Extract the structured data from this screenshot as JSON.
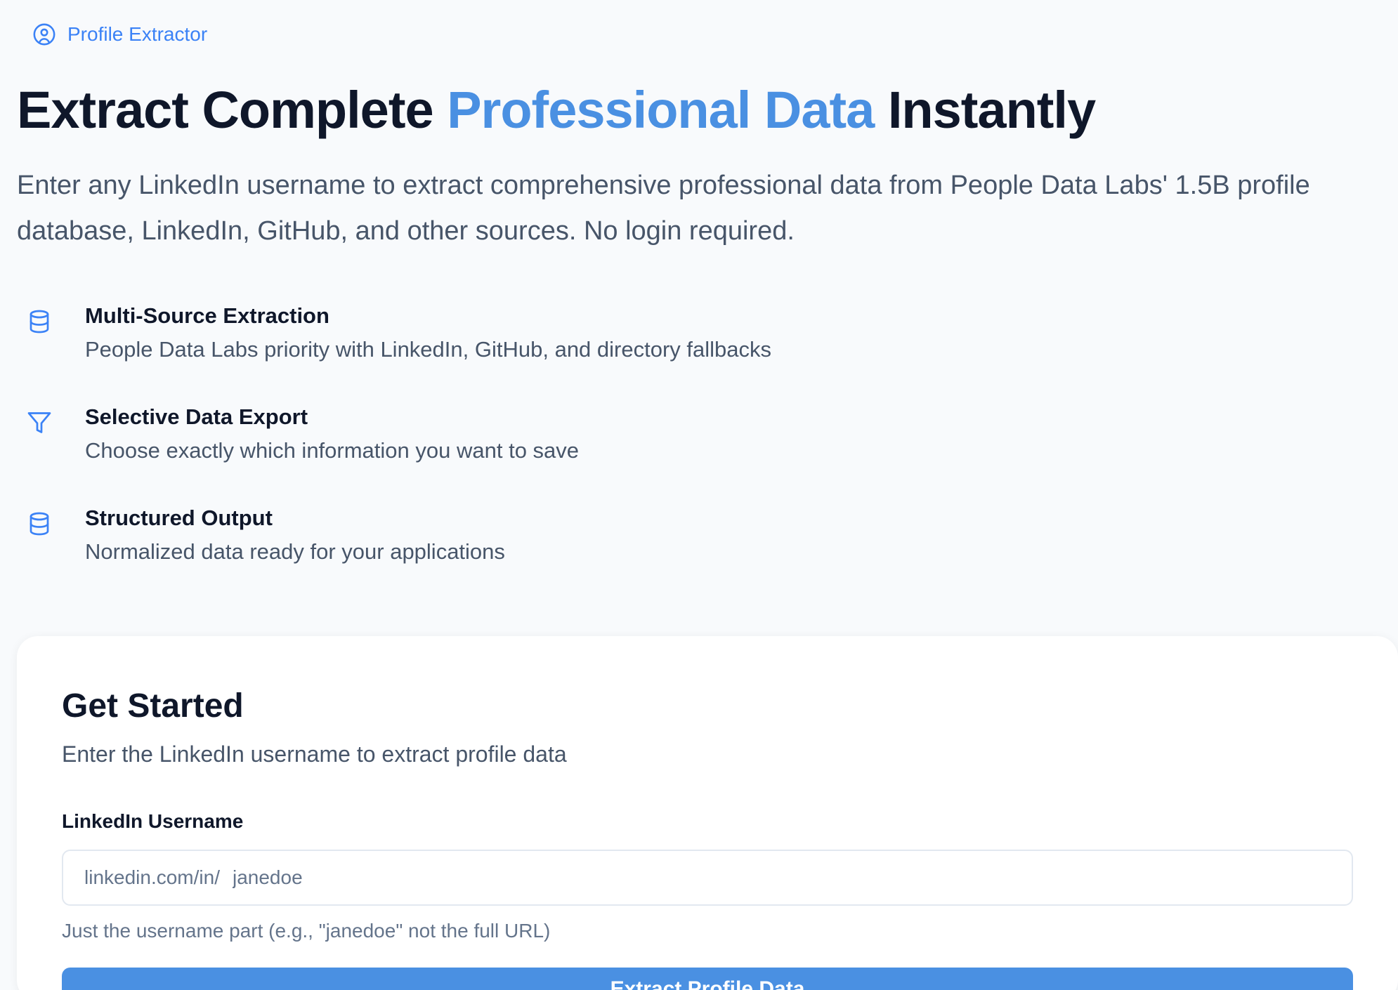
{
  "brand": {
    "label": "Profile Extractor",
    "icon": "user-circle-icon"
  },
  "hero": {
    "headline_before": "Extract Complete ",
    "headline_accent": "Professional Data",
    "headline_after": " Instantly",
    "lead": "Enter any LinkedIn username to extract comprehensive professional data from People Data Labs' 1.5B profile database, LinkedIn, GitHub, and other sources. No login required."
  },
  "features": [
    {
      "icon": "database-icon",
      "title": "Multi-Source Extraction",
      "description": "People Data Labs priority with LinkedIn, GitHub, and directory fallbacks"
    },
    {
      "icon": "filter-icon",
      "title": "Selective Data Export",
      "description": "Choose exactly which information you want to save"
    },
    {
      "icon": "database-icon",
      "title": "Structured Output",
      "description": "Normalized data ready for your applications"
    }
  ],
  "form": {
    "title": "Get Started",
    "subtitle": "Enter the LinkedIn username to extract profile data",
    "field_label": "LinkedIn Username",
    "prefix": "linkedin.com/in/",
    "placeholder": "janedoe",
    "value": "",
    "hint": "Just the username part (e.g., \"janedoe\" not the full URL)",
    "submit_label": "Extract Profile Data"
  },
  "colors": {
    "accent": "#4a90e2",
    "icon": "#3b82f6",
    "background": "#f8fafc",
    "text_primary": "#0f172a",
    "text_secondary": "#475569"
  }
}
